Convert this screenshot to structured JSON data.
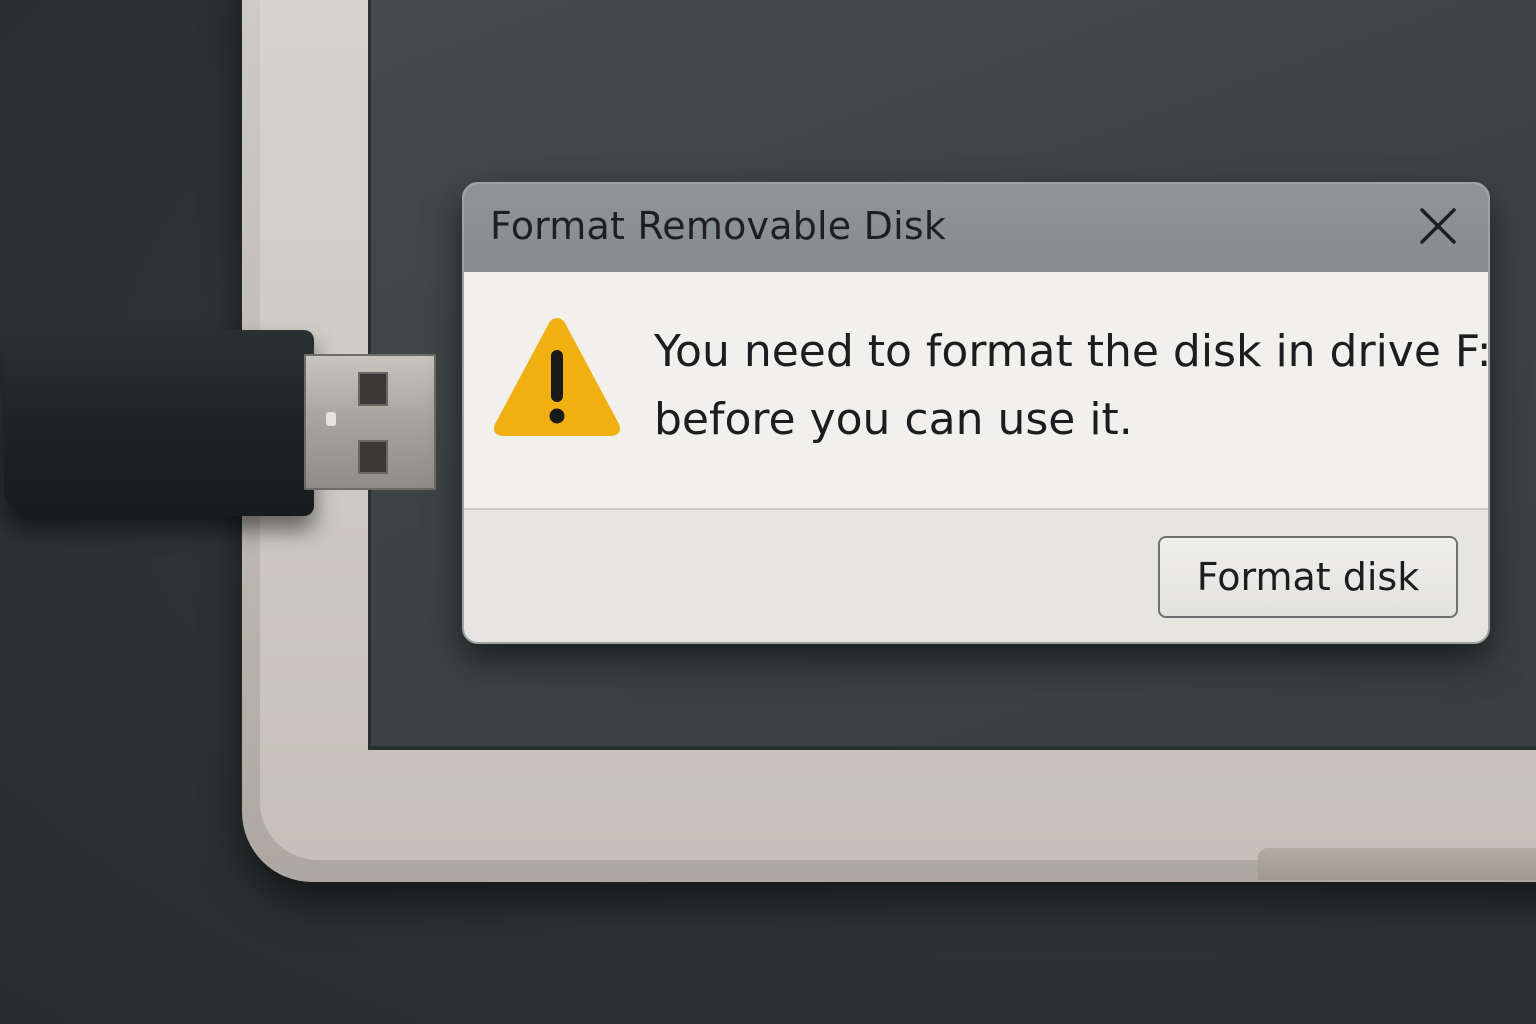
{
  "dialog": {
    "title": "Format Removable Disk",
    "message_line1": "You need to format the disk in drive F:",
    "message_line2": "before you can use it.",
    "primary_button_label": "Format disk",
    "icon": "warning-icon",
    "close_icon": "close-icon"
  },
  "colors": {
    "warning_yellow": "#f0b012",
    "titlebar": "#8a9192",
    "dialog_body": "#f1f0ed",
    "dialog_footer": "#e6e5e2"
  }
}
